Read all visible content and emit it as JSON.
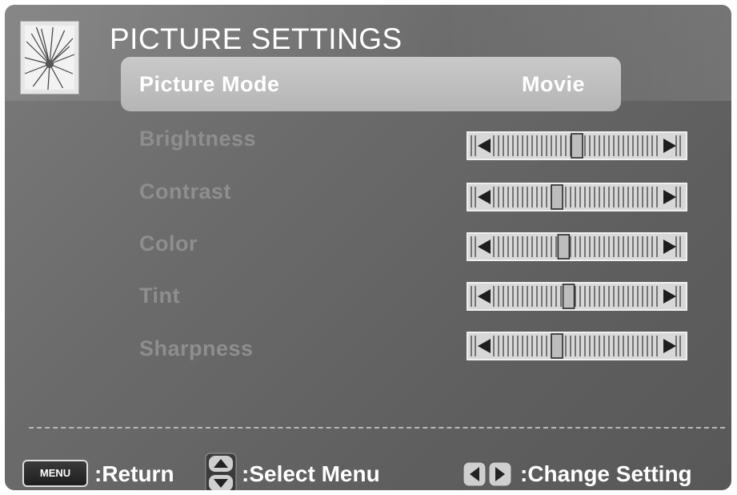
{
  "title": "PICTURE SETTINGS",
  "thumbnail_icon": "picture-thumbnail-icon",
  "picture_mode": {
    "label": "Picture Mode",
    "value": "Movie"
  },
  "settings": [
    {
      "label": "Brightness",
      "level": 0.5
    },
    {
      "label": "Contrast",
      "level": 0.38
    },
    {
      "label": "Color",
      "level": 0.42
    },
    {
      "label": "Tint",
      "level": 0.45
    },
    {
      "label": "Sharpness",
      "level": 0.38
    }
  ],
  "footer": {
    "menu_key": "MENU",
    "return_label": ":Return",
    "select_label": ":Select Menu",
    "change_label": ":Change Setting",
    "select_icon": "up-down-icon",
    "change_icon": "left-right-icon"
  },
  "colors": {
    "background": "#6b6b6b",
    "highlight": "#bdbdbd",
    "inactive_text": "#8e8e8e",
    "active_text": "#ffffff"
  }
}
